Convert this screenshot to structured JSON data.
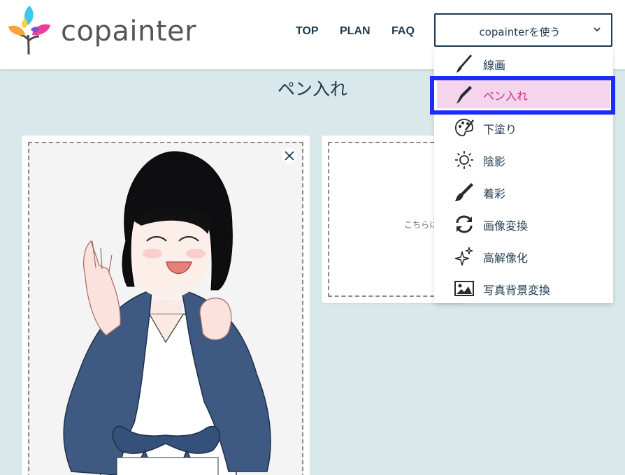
{
  "header": {
    "brand": "copainter",
    "nav": [
      {
        "label": "TOP"
      },
      {
        "label": "PLAN"
      },
      {
        "label": "FAQ"
      }
    ],
    "use_button": "copainterを使う"
  },
  "page": {
    "title": "ペン入れ"
  },
  "dropzone_right": {
    "text": "こちらに"
  },
  "menu": {
    "items": [
      {
        "label": "線画",
        "icon": "brush-icon"
      },
      {
        "label": "ペン入れ",
        "icon": "pen-nib-icon",
        "active": true
      },
      {
        "label": "下塗り",
        "icon": "palette-icon"
      },
      {
        "label": "陰影",
        "icon": "sun-icon"
      },
      {
        "label": "着彩",
        "icon": "paintbrush-icon"
      },
      {
        "label": "画像変換",
        "icon": "sync-arrows-icon"
      },
      {
        "label": "高解像化",
        "icon": "sparkles-icon"
      },
      {
        "label": "写真背景変換",
        "icon": "image-icon"
      }
    ]
  },
  "colors": {
    "page_bg": "#d9e8ea",
    "text_navy": "#1e3a52",
    "active_bg": "#f5d5ec",
    "active_text": "#c8308e",
    "highlight": "#1a2cf5"
  }
}
